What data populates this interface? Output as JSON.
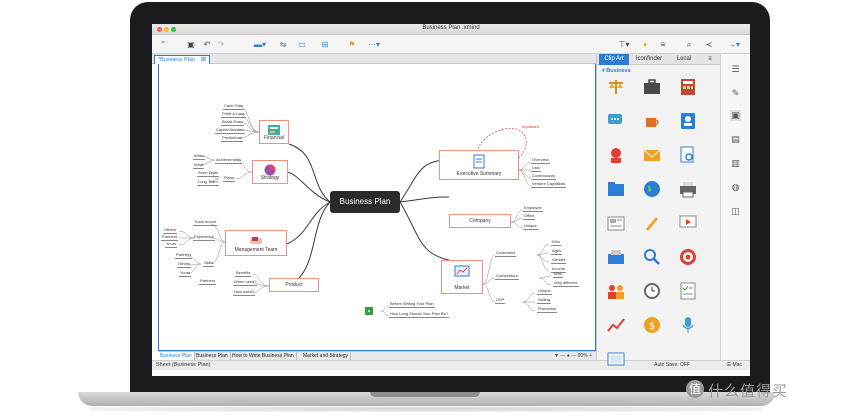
{
  "window": {
    "title": "Business Plan .xmind"
  },
  "doc_tab": {
    "label": "*Business Plan",
    "close": "⊠"
  },
  "center_topic": "Business Plan",
  "main_topics": {
    "financial": "Financial",
    "strategy": "Strategy",
    "team": "Management Team",
    "product": "Product",
    "exec": "Executive Summary",
    "company": "Company",
    "market": "Market"
  },
  "financial_subs": [
    "Cash Flow",
    "Profit & Loss",
    "Break Even",
    "Capital Needed",
    "Predictions"
  ],
  "strategy_subs": {
    "when": "When",
    "what": "What",
    "achievements": "Achievements",
    "short": "Short Team",
    "long": "Long Team",
    "plans": "Plans"
  },
  "team_subs": {
    "others1": "Others",
    "partners1": "Partners",
    "yours1": "Yours",
    "track": "Track record",
    "experience": "Experience",
    "partners2": "Partners",
    "others2": "Others",
    "yours2": "Yours",
    "skills": "Skills",
    "partners3": "Partners"
  },
  "product_subs": {
    "benefits": "Benefits",
    "when_used": "When used?",
    "how_used": "How used?"
  },
  "exec_subs": {
    "important": "Important",
    "overview": "Overview",
    "last": "Last",
    "continuously": "Continuously",
    "venture": "Venture Capitalists"
  },
  "company_subs": {
    "employee": "Employee",
    "office": "Office",
    "unique": "Unique"
  },
  "market_subs": {
    "customers": "Customers",
    "who": "Who",
    "ages": "Ages",
    "gender": "Gender",
    "income": "Income",
    "competitors": "Competitors",
    "who2": "Who",
    "why_different": "Why different",
    "usp": "USP",
    "unique": "Unique",
    "selling": "Selling",
    "promotion": "Promotion"
  },
  "floating": {
    "before": "Before Writing Your Plan",
    "how_long": "How Long Should Your Plan Be?"
  },
  "sheet_tabs": [
    "Business Plan",
    "Business Plan",
    "How to Write Business Plan",
    "Market and Strategy"
  ],
  "zoom": "90%",
  "status": {
    "sheet": "Sheet (Business Plan)",
    "autosave": "Auto Save: OFF",
    "user": "☰ Mac"
  },
  "panel": {
    "tabs": [
      "Clip Art",
      "Iconfinder",
      "Local"
    ],
    "category": "Business"
  },
  "watermark": {
    "text": "什么值得买",
    "logo": "值"
  },
  "colors": {
    "accent": "#2a7fd4",
    "topic_border": "#f0917a",
    "center_bg": "#2b2b2b"
  }
}
